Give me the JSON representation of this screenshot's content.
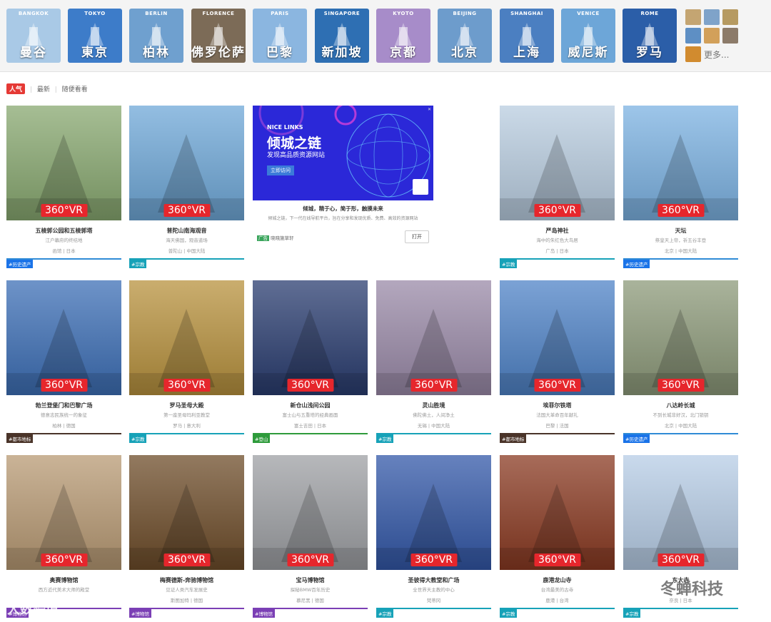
{
  "cities": [
    {
      "en": "BANGKOK",
      "cn": "曼谷",
      "color": "#a9c9e6"
    },
    {
      "en": "TOKYO",
      "cn": "東京",
      "color": "#3d7cc9"
    },
    {
      "en": "BERLIN",
      "cn": "柏林",
      "color": "#6fa0cf"
    },
    {
      "en": "FLORENCE",
      "cn": "佛罗伦萨",
      "color": "#7c6b57"
    },
    {
      "en": "PARIS",
      "cn": "巴黎",
      "color": "#8bb6e0"
    },
    {
      "en": "SINGAPORE",
      "cn": "新加坡",
      "color": "#2e6fb3"
    },
    {
      "en": "KYOTO",
      "cn": "京都",
      "color": "#a78cc9"
    },
    {
      "en": "BEIJING",
      "cn": "北京",
      "color": "#6d9ccc"
    },
    {
      "en": "SHANGHAI",
      "cn": "上海",
      "color": "#4b7fc1"
    },
    {
      "en": "VENICE",
      "cn": "威尼斯",
      "color": "#6da6d8"
    },
    {
      "en": "ROME",
      "cn": "罗马",
      "color": "#2b5ea8"
    }
  ],
  "more_label": "更多...",
  "tabs": {
    "hot": "人气",
    "new": "最新",
    "random": "随便看看"
  },
  "vr_label": "360°VR",
  "cards": [
    {
      "title": "五棱郭公园和五棱郭塔",
      "subtitle": "江户幕府的终结地",
      "loc": "函馆 | 日本",
      "tag": "#历史遗产",
      "tagColor": "#1a73e8",
      "line": "#2f8bd6",
      "bg": "#88a870"
    },
    {
      "title": "普陀山南海观音",
      "subtitle": "海天佛国，观音道场",
      "loc": "普陀山 | 中国大陆",
      "tag": "#宗教",
      "tagColor": "#17a2b8",
      "line": "#17a2b8",
      "bg": "#6fa8d8"
    },
    {
      "title": "严岛神社",
      "subtitle": "海中的朱红色大鸟居",
      "loc": "广岛 | 日本",
      "tag": "#宗教",
      "tagColor": "#17a2b8",
      "line": "#17a2b8",
      "bg": "#b9cde0"
    },
    {
      "title": "天坛",
      "subtitle": "祭皇天上帝，祈五谷丰登",
      "loc": "北京 | 中国大陆",
      "tag": "#历史遗产",
      "tagColor": "#1a73e8",
      "line": "#2f8bd6",
      "bg": "#7cb2e2"
    },
    {
      "title": "勃兰登堡门和巴黎广场",
      "subtitle": "德意志民族统一的象征",
      "loc": "柏林 | 德国",
      "tag": "#都市地标",
      "tagColor": "#4a3429",
      "line": "#4a3429",
      "bg": "#3d6fb6"
    },
    {
      "title": "罗马圣母大殿",
      "subtitle": "第一座圣母玛利亚教堂",
      "loc": "罗马 | 意大利",
      "tag": "#宗教",
      "tagColor": "#17a2b8",
      "line": "#17a2b8",
      "bg": "#b8923e"
    },
    {
      "title": "新仓山浅间公园",
      "subtitle": "富士山与五重塔的经典画面",
      "loc": "富士吉田 | 日本",
      "tag": "#登山",
      "tagColor": "#2e9b3b",
      "line": "#2e9b3b",
      "bg": "#2a3d70"
    },
    {
      "title": "灵山胜境",
      "subtitle": "佛陀佛土，人间净土",
      "loc": "无锡 | 中国大陆",
      "tag": "#宗教",
      "tagColor": "#17a2b8",
      "line": "#17a2b8",
      "bg": "#9a8aa8"
    },
    {
      "title": "埃菲尔铁塔",
      "subtitle": "法国大革命百年献礼",
      "loc": "巴黎 | 法国",
      "tag": "#都市地标",
      "tagColor": "#4a3429",
      "line": "#4a3429",
      "bg": "#4f83c7"
    },
    {
      "title": "八达岭长城",
      "subtitle": "不到长城非好汉，北门锁钥",
      "loc": "北京 | 中国大陆",
      "tag": "#历史遗产",
      "tagColor": "#1a73e8",
      "line": "#2f8bd6",
      "bg": "#8d9a7a"
    },
    {
      "title": "奥赛博物馆",
      "subtitle": "西方近代美术大师的殿堂",
      "loc": "",
      "tag": "#博物馆",
      "tagColor": "#7b3fb5",
      "line": "#7b3fb5",
      "bg": "#b89a74"
    },
    {
      "title": "梅赛德斯-奔驰博物馆",
      "subtitle": "见证人类汽车发展史",
      "loc": "斯图加特 | 德国",
      "tag": "#博物馆",
      "tagColor": "#7b3fb5",
      "line": "#7b3fb5",
      "bg": "#6e4d2a"
    },
    {
      "title": "宝马博物馆",
      "subtitle": "探秘BMW百年历史",
      "loc": "慕尼黑 | 德国",
      "tag": "#博物馆",
      "tagColor": "#7b3fb5",
      "line": "#7b3fb5",
      "bg": "#9ea0a4"
    },
    {
      "title": "圣彼得大教堂和广场",
      "subtitle": "全世界天主教的中心",
      "loc": "梵蒂冈",
      "tag": "#宗教",
      "tagColor": "#17a2b8",
      "line": "#17a2b8",
      "bg": "#3358a8"
    },
    {
      "title": "鹿港龙山寺",
      "subtitle": "台湾最美的古寺",
      "loc": "鹿港 | 台湾",
      "tag": "#宗教",
      "tagColor": "#17a2b8",
      "line": "#17a2b8",
      "bg": "#8a3a22"
    },
    {
      "title": "东大寺",
      "subtitle": "",
      "loc": "奈良 | 日本",
      "tag": "#宗教",
      "tagColor": "#17a2b8",
      "line": "#17a2b8",
      "bg": "#b7cde6"
    }
  ],
  "ad": {
    "brand": "NICE LINKS",
    "headline": "倾城之链",
    "tagline": "发现高品质资源网站",
    "cta_img": "立即访问",
    "badge": "广告",
    "title": "倾城，精于心，简于形，触摸未来",
    "desc": "倾城之链，下一代在线导航平台，旨在分享和发现优质、免费、高效的资源网站",
    "advertiser": "晓晓施草轩",
    "open": "打开"
  },
  "watermarks": {
    "left": "大数跨境",
    "right": "冬蝉科技"
  }
}
